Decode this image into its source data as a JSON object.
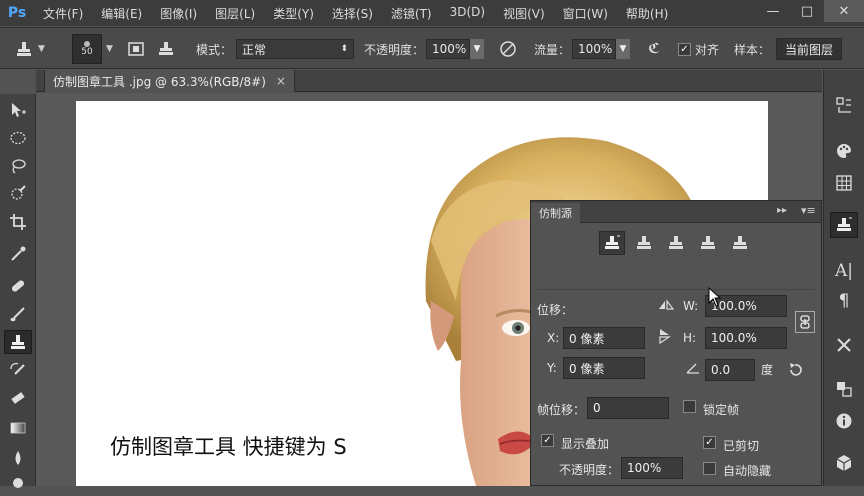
{
  "app": {
    "logo": "Ps"
  },
  "menu": [
    "文件(F)",
    "编辑(E)",
    "图像(I)",
    "图层(L)",
    "类型(Y)",
    "选择(S)",
    "滤镜(T)",
    "3D(D)",
    "视图(V)",
    "窗口(W)",
    "帮助(H)"
  ],
  "window_controls": {
    "minimize": "—",
    "maximize": "□",
    "close": "✕"
  },
  "options": {
    "brush_size": "50",
    "mode_label": "模式：",
    "mode_value": "正常",
    "opacity_label": "不透明度：",
    "opacity_value": "100%",
    "flow_label": "流量：",
    "flow_value": "100%",
    "aligned_label": "对齐",
    "aligned_checked": "✓",
    "sample_label": "样本：",
    "sample_value": "当前图层"
  },
  "document": {
    "tab_title": "仿制图章工具 .jpg @ 63.3%(RGB/8#)",
    "close": "×"
  },
  "caption": "仿制图章工具 快捷键为 S",
  "panel": {
    "title": "仿制源",
    "offset_label": "位移：",
    "w_label": "W:",
    "w_value": "100.0%",
    "h_label": "H:",
    "h_value": "100.0%",
    "x_label": "X:",
    "x_value": "0 像素",
    "y_label": "Y:",
    "y_value": "0 像素",
    "angle_value": "0.0",
    "angle_unit": "度",
    "frame_offset_label": "帧位移：",
    "frame_offset_value": "0",
    "lock_frame_label": "锁定帧",
    "show_overlay_label": "显示叠加",
    "clipped_label": "已剪切",
    "overlay_opacity_label": "不透明度：",
    "overlay_opacity_value": "100%",
    "auto_hide_label": "自动隐藏",
    "check_mark": "✓"
  },
  "colors": {
    "menubar": "#3c3c3c",
    "panel": "#535353",
    "accent": "#4fa7ff"
  }
}
